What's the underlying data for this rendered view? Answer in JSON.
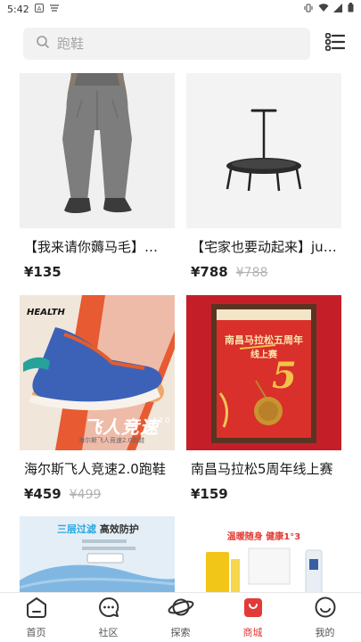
{
  "status_bar": {
    "time": "5:42"
  },
  "search": {
    "placeholder": "跑鞋"
  },
  "products": [
    {
      "title": "【我来请你薅马毛】马拉松",
      "price": "¥135",
      "original_price": ""
    },
    {
      "title": "【宅家也要动起来】jump",
      "price": "¥788",
      "original_price": "¥788"
    },
    {
      "title": "海尔斯飞人竞速2.0跑鞋",
      "price": "¥459",
      "original_price": "¥499",
      "image_text": {
        "brand": "HEALTH",
        "slogan": "飞人竞速",
        "version": "2.0",
        "caption": "海尔斯飞人竞速2.0跑鞋"
      }
    },
    {
      "title": "南昌马拉松5周年线上赛",
      "price": "¥159",
      "original_price": "",
      "image_text": {
        "header": "南昌马拉松五周年",
        "sub": "线上赛"
      }
    },
    {
      "title": "",
      "price": "",
      "original_price": "",
      "image_text": {
        "headline_a": "三层过滤",
        "headline_b": "高效防护"
      }
    },
    {
      "title": "",
      "price": "",
      "original_price": "",
      "image_text": {
        "headline": "温暖随身  健康1°3"
      }
    }
  ],
  "tabs": [
    {
      "label": "首页",
      "icon": "home-icon",
      "active": false
    },
    {
      "label": "社区",
      "icon": "chat-bubble-icon",
      "active": false
    },
    {
      "label": "探索",
      "icon": "planet-icon",
      "active": false
    },
    {
      "label": "商城",
      "icon": "shopping-bag-icon",
      "active": true
    },
    {
      "label": "我的",
      "icon": "smiley-face-icon",
      "active": false
    }
  ],
  "colors": {
    "accent": "#e23a37",
    "search_bg": "#f2f2f2",
    "strike": "#b3b3b3"
  }
}
